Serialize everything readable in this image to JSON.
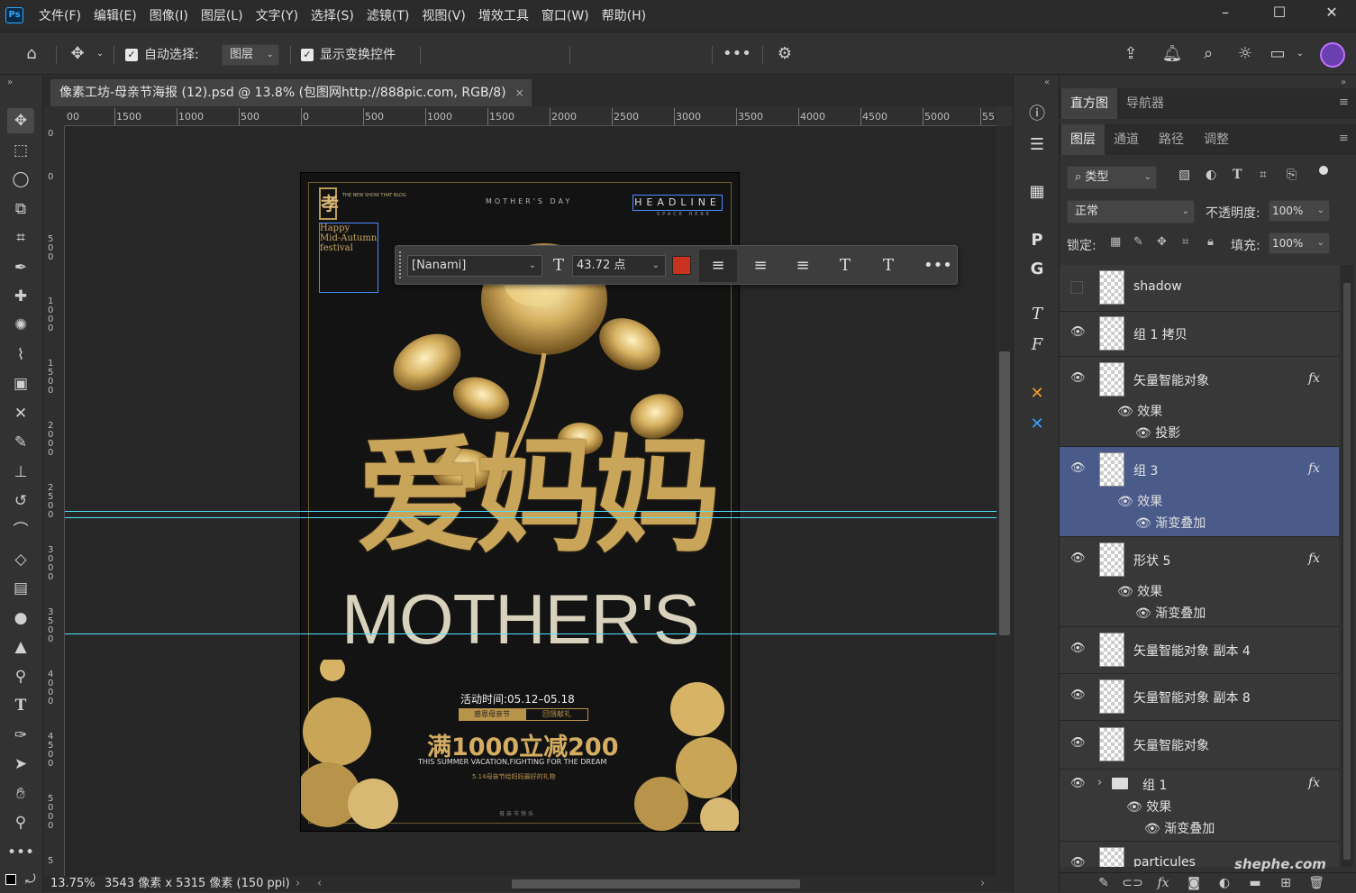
{
  "app": {
    "logo": "Ps"
  },
  "menu": [
    "文件(F)",
    "编辑(E)",
    "图像(I)",
    "图层(L)",
    "文字(Y)",
    "选择(S)",
    "滤镜(T)",
    "视图(V)",
    "增效工具",
    "窗口(W)",
    "帮助(H)"
  ],
  "window_controls": {
    "minimize": "–",
    "maximize": "☐",
    "close": "✕"
  },
  "options_bar": {
    "auto_select_label": "自动选择:",
    "auto_select_target": "图层",
    "show_transform_label": "显示变换控件",
    "more": "•••"
  },
  "document": {
    "tab_title": "像素工坊-母亲节海报 (12).psd @ 13.8% (包图网http://888pic.com, RGB/8)",
    "close": "×"
  },
  "rulers": {
    "horizontal": [
      "00",
      "1500",
      "1000",
      "500",
      "0",
      "500",
      "1000",
      "1500",
      "2000",
      "2500",
      "3000",
      "3500",
      "4000",
      "4500",
      "5000",
      "55"
    ],
    "vertical": [
      "0",
      "0",
      "500",
      "1000",
      "1500",
      "2000",
      "2500",
      "3000",
      "3500",
      "4000",
      "4500",
      "5000",
      "5"
    ]
  },
  "poster": {
    "top_small": "THE NEW SHOW THAT BLOG",
    "mothers_day": "MOTHER'S DAY",
    "headline": "HEADLINE",
    "space_here": "SPACE HERE",
    "festival_lines": [
      "Happy",
      "Mid-Autumn",
      "festival"
    ],
    "chinese_title": "爱妈妈",
    "english_title": "MOTHER'S",
    "event_time": "活动时间:05.12–05.18",
    "tag_left": "感恩母亲节",
    "tag_right": "回馈献礼",
    "promo": "满1000立减200",
    "promo_sub": "THIS SUMMER VACATION,FIGHTING FOR THE DREAM",
    "promo_sub2": "5.14母亲节给妈妈最好的礼物",
    "footer": "母亲节快乐"
  },
  "text_options": {
    "font": "[Nanami]",
    "size": "43.72 点",
    "color": "#c8321e",
    "more": "•••"
  },
  "status": {
    "zoom": "13.75%",
    "dimensions": "3543 像素 x 5315 像素 (150 ppi)"
  },
  "panel_tabs_top": [
    "直方图",
    "导航器"
  ],
  "panel_tabs_layers": [
    "图层",
    "通道",
    "路径",
    "调整"
  ],
  "layers_controls": {
    "filter_type": "类型",
    "blend_mode": "正常",
    "opacity_label": "不透明度:",
    "opacity_value": "100%",
    "lock_label": "锁定:",
    "fill_label": "填充:",
    "fill_value": "100%"
  },
  "layers": [
    {
      "name": "shadow",
      "visible": false,
      "fx": false,
      "effects": []
    },
    {
      "name": "组 1 拷贝",
      "visible": true,
      "fx": false,
      "effects": []
    },
    {
      "name": "矢量智能对象",
      "visible": true,
      "fx": true,
      "effects": [
        "效果",
        "投影"
      ]
    },
    {
      "name": "组 3",
      "visible": true,
      "fx": true,
      "selected": true,
      "effects": [
        "效果",
        "渐变叠加"
      ]
    },
    {
      "name": "形状 5",
      "visible": true,
      "fx": true,
      "effects": [
        "效果",
        "渐变叠加"
      ]
    },
    {
      "name": "矢量智能对象 副本 4",
      "visible": true,
      "fx": false,
      "effects": []
    },
    {
      "name": "矢量智能对象 副本 8",
      "visible": true,
      "fx": false,
      "effects": []
    },
    {
      "name": "矢量智能对象",
      "visible": true,
      "fx": false,
      "effects": []
    },
    {
      "name": "组 1",
      "visible": true,
      "fx": true,
      "group": true,
      "effects": [
        "效果",
        "渐变叠加"
      ]
    },
    {
      "name": "particules",
      "visible": true,
      "fx": false,
      "effects": []
    }
  ],
  "watermark": "shephe.com"
}
